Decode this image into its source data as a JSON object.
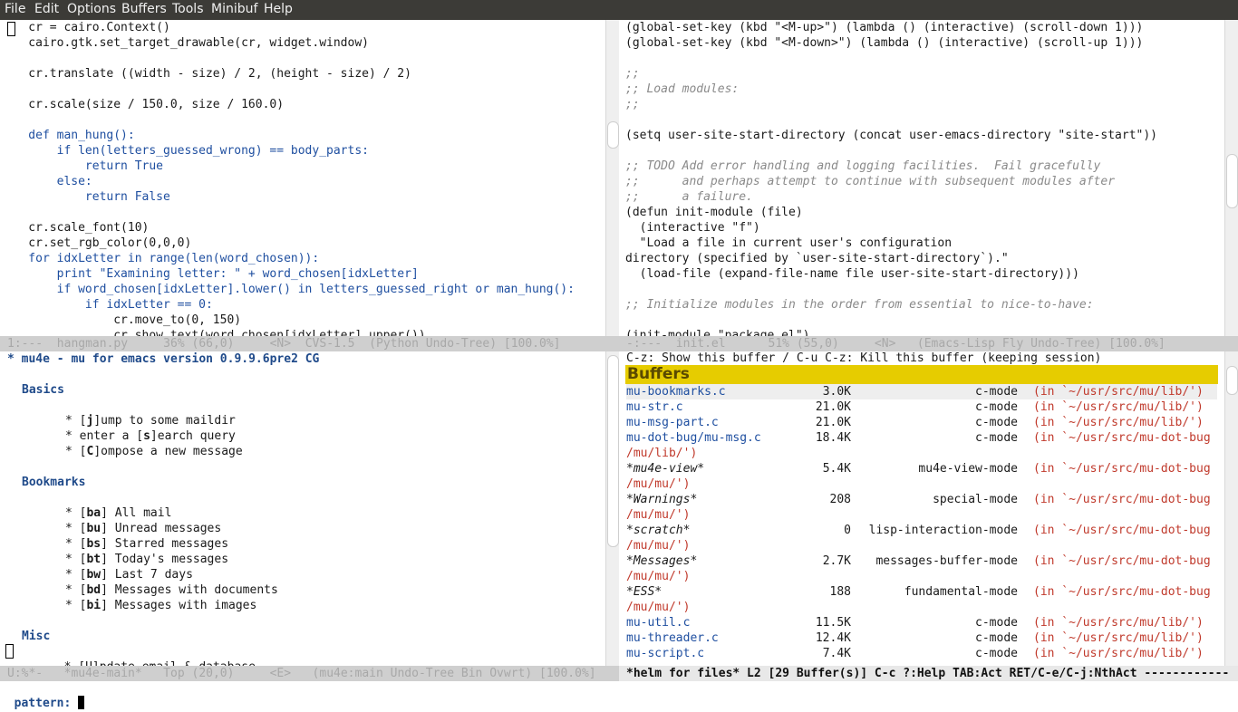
{
  "menu": [
    "File",
    "Edit",
    "Options",
    "Buffers",
    "Tools",
    "Minibuf",
    "Help"
  ],
  "python_pane": {
    "lines": [
      "    cr = cairo.Context()",
      "    cairo.gtk.set_target_drawable(cr, widget.window)",
      "",
      "    cr.translate ((width - size) / 2, (height - size) / 2)",
      "",
      "    cr.scale(size / 150.0, size / 160.0)",
      "",
      "    def man_hung():",
      "        if len(letters_guessed_wrong) == body_parts:",
      "            return True",
      "        else:",
      "            return False",
      "",
      "    cr.scale_font(10)",
      "    cr.set_rgb_color(0,0,0)",
      "    for idxLetter in range(len(word_chosen)):",
      "        print \"Examining letter: \" + word_chosen[idxLetter]",
      "        if word_chosen[idxLetter].lower() in letters_guessed_right or man_hung():",
      "            if idxLetter == 0:",
      "                cr.move_to(0, 150)",
      "                cr.show_text(word_chosen[idxLetter].upper())"
    ],
    "modeline": "1:---  hangman.py     36% (66,0)     <N>  CVS-1.5  (Python Undo-Tree) [100.0%]"
  },
  "elisp_pane": {
    "lines": [
      "(global-set-key (kbd \"<M-up>\") (lambda () (interactive) (scroll-down 1)))",
      "(global-set-key (kbd \"<M-down>\") (lambda () (interactive) (scroll-up 1)))",
      "",
      ";;",
      ";; Load modules:",
      ";;",
      "",
      "(setq user-site-start-directory (concat user-emacs-directory \"site-start\"))",
      "",
      ";; TODO Add error handling and logging facilities.  Fail gracefully",
      ";;      and perhaps attempt to continue with subsequent modules after",
      ";;      a failure.",
      "(defun init-module (file)",
      "  (interactive \"f\")",
      "  \"Load a file in current user's configuration",
      "directory (specified by `user-site-start-directory`).\"",
      "  (load-file (expand-file-name file user-site-start-directory)))",
      "",
      ";; Initialize modules in the order from essential to nice-to-have:",
      "",
      "(init-module \"package.el\")"
    ],
    "modeline": "-:---  init.el      51% (55,0)     <N>   (Emacs-Lisp Fly Undo-Tree) [100.0%]"
  },
  "mu4e_pane": {
    "title": "* mu4e - mu for emacs version 0.9.9.6pre2 CG",
    "basics_heading": "Basics",
    "basics": [
      {
        "key": "j",
        "pre": "* [",
        "post": "]ump to some maildir"
      },
      {
        "key": "s",
        "pre": "* enter a [",
        "post": "]earch query"
      },
      {
        "key": "C",
        "pre": "* [",
        "post": "]ompose a new message"
      }
    ],
    "bookmarks_heading": "Bookmarks",
    "bookmarks": [
      {
        "key": "ba",
        "label": "All mail"
      },
      {
        "key": "bu",
        "label": "Unread messages"
      },
      {
        "key": "bs",
        "label": "Starred messages"
      },
      {
        "key": "bt",
        "label": "Today's messages"
      },
      {
        "key": "bw",
        "label": "Last 7 days"
      },
      {
        "key": "bd",
        "label": "Messages with documents"
      },
      {
        "key": "bi",
        "label": "Messages with images"
      }
    ],
    "misc_heading": "Misc",
    "misc_partial": "        * [U]pdate email & database",
    "modeline": "U:%*-   *mu4e-main*   Top (20,0)     <E>   (mu4e:main Undo-Tree Bin Ovwrt) [100.0%]"
  },
  "helm_pane": {
    "hint": "C-z: Show this buffer / C-u C-z: Kill this buffer (keeping session)",
    "header": "Buffers",
    "rows": [
      {
        "name": "mu-bookmarks.c",
        "size": "3.0K",
        "mode": "c-mode",
        "dir": "(in `~/usr/src/mu/lib/')",
        "wrap": ""
      },
      {
        "name": "mu-str.c",
        "size": "21.0K",
        "mode": "c-mode",
        "dir": "(in `~/usr/src/mu/lib/')",
        "wrap": ""
      },
      {
        "name": "mu-msg-part.c",
        "size": "21.0K",
        "mode": "c-mode",
        "dir": "(in `~/usr/src/mu/lib/')",
        "wrap": ""
      },
      {
        "name": "mu-dot-bug/mu-msg.c",
        "size": "18.4K",
        "mode": "c-mode",
        "dir": "(in `~/usr/src/mu-dot-bug",
        "wrap": "/mu/lib/')"
      },
      {
        "name": "*mu4e-view*",
        "size": "5.4K",
        "mode": "mu4e-view-mode",
        "dir": "(in `~/usr/src/mu-dot-bug",
        "wrap": "/mu/mu/')"
      },
      {
        "name": "*Warnings*",
        "size": "208",
        "mode": "special-mode",
        "dir": "(in `~/usr/src/mu-dot-bug",
        "wrap": "/mu/mu/')"
      },
      {
        "name": "*scratch*",
        "size": "0",
        "mode": "lisp-interaction-mode",
        "dir": "(in `~/usr/src/mu-dot-bug",
        "wrap": "/mu/mu/')"
      },
      {
        "name": "*Messages*",
        "size": "2.7K",
        "mode": "messages-buffer-mode",
        "dir": "(in `~/usr/src/mu-dot-bug",
        "wrap": "/mu/mu/')"
      },
      {
        "name": "*ESS*",
        "size": "188",
        "mode": "fundamental-mode",
        "dir": "(in `~/usr/src/mu-dot-bug",
        "wrap": "/mu/mu/')"
      },
      {
        "name": "mu-util.c",
        "size": "11.5K",
        "mode": "c-mode",
        "dir": "(in `~/usr/src/mu/lib/')",
        "wrap": ""
      },
      {
        "name": "mu-threader.c",
        "size": "12.4K",
        "mode": "c-mode",
        "dir": "(in `~/usr/src/mu/lib/')",
        "wrap": ""
      },
      {
        "name": "mu-script.c",
        "size": "7.4K",
        "mode": "c-mode",
        "dir": "(in `~/usr/src/mu/lib/')",
        "wrap": ""
      }
    ],
    "modeline": "*helm for files* L2 [29 Buffer(s)] C-c ?:Help TAB:Act RET/C-e/C-j:NthAct ------------"
  },
  "minibuffer": {
    "prompt": "pattern: ",
    "value": ""
  }
}
